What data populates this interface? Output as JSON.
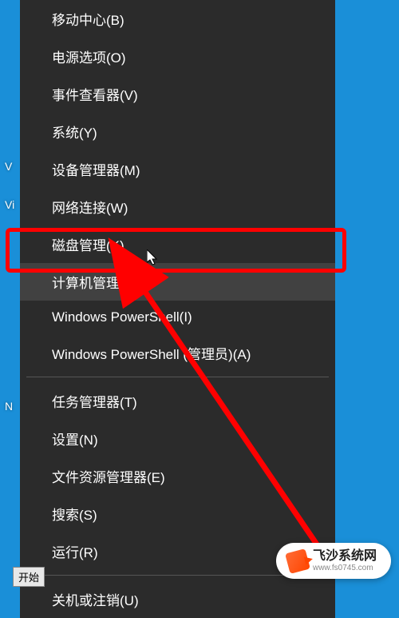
{
  "menu": {
    "items": [
      {
        "label": "移动中心(B)",
        "highlighted": false
      },
      {
        "label": "电源选项(O)",
        "highlighted": false
      },
      {
        "label": "事件查看器(V)",
        "highlighted": false
      },
      {
        "label": "系统(Y)",
        "highlighted": false
      },
      {
        "label": "设备管理器(M)",
        "highlighted": false
      },
      {
        "label": "网络连接(W)",
        "highlighted": false
      },
      {
        "label": "磁盘管理(K)",
        "highlighted": false
      },
      {
        "label": "计算机管理(G)",
        "highlighted": true
      },
      {
        "label": "Windows PowerShell(I)",
        "highlighted": false
      },
      {
        "label": "Windows PowerShell (管理员)(A)",
        "highlighted": false
      },
      {
        "divider": true
      },
      {
        "label": "任务管理器(T)",
        "highlighted": false
      },
      {
        "label": "设置(N)",
        "highlighted": false
      },
      {
        "label": "文件资源管理器(E)",
        "highlighted": false
      },
      {
        "label": "搜索(S)",
        "highlighted": false
      },
      {
        "label": "运行(R)",
        "highlighted": false
      },
      {
        "divider": true
      },
      {
        "label": "关机或注销(U)",
        "highlighted": false
      }
    ]
  },
  "desktop": {
    "icon1": "V",
    "icon2": "Vi",
    "icon3": "N"
  },
  "start_label": "开始",
  "watermark": {
    "title": "飞沙系统网",
    "url": "www.fs0745.com"
  },
  "colors": {
    "desktop_bg": "#1a8fd8",
    "menu_bg": "#2b2b2b",
    "menu_highlight": "#414141",
    "annotation_red": "#ff0000"
  }
}
